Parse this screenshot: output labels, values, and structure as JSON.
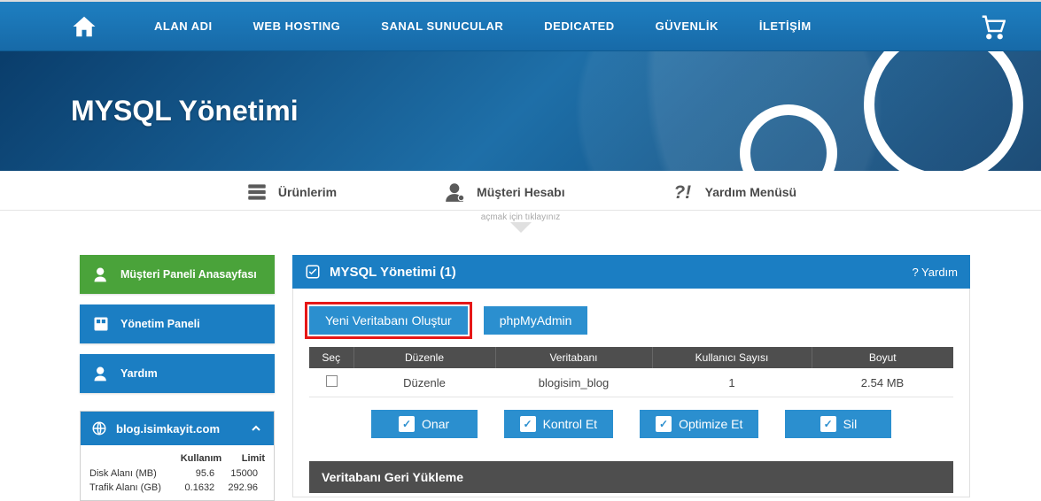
{
  "nav": {
    "items": [
      "ALAN ADI",
      "WEB HOSTING",
      "SANAL SUNUCULAR",
      "DEDICATED",
      "GÜVENLİK",
      "İLETİŞİM"
    ]
  },
  "hero": {
    "title": "MYSQL Yönetimi"
  },
  "submenu": {
    "items": [
      "Ürünlerim",
      "Müşteri Hesabı",
      "Yardım Menüsü"
    ],
    "hint": "açmak için tıklayınız"
  },
  "sidebar": {
    "home": "Müşteri Paneli Anasayfası",
    "panel": "Yönetim Paneli",
    "help": "Yardım",
    "domain": {
      "name": "blog.isimkayit.com",
      "cols": [
        "Kullanım",
        "Limit"
      ],
      "rows": [
        {
          "label": "Disk Alanı (MB)",
          "usage": "95.6",
          "limit": "15000"
        },
        {
          "label": "Trafik Alanı (GB)",
          "usage": "0.1632",
          "limit": "292.96"
        }
      ]
    }
  },
  "content": {
    "title": "MYSQL Yönetimi (1)",
    "help": "? Yardım",
    "buttons": {
      "create": "Yeni Veritabanı Oluştur",
      "pma": "phpMyAdmin"
    },
    "table": {
      "headers": [
        "Seç",
        "Düzenle",
        "Veritabanı",
        "Kullanıcı Sayısı",
        "Boyut"
      ],
      "rows": [
        {
          "edit": "Düzenle",
          "db": "blogisim_blog",
          "users": "1",
          "size": "2.54 MB"
        }
      ]
    },
    "actions": {
      "repair": "Onar",
      "check": "Kontrol Et",
      "optimize": "Optimize Et",
      "delete": "Sil"
    },
    "restore": "Veritabanı Geri Yükleme"
  }
}
